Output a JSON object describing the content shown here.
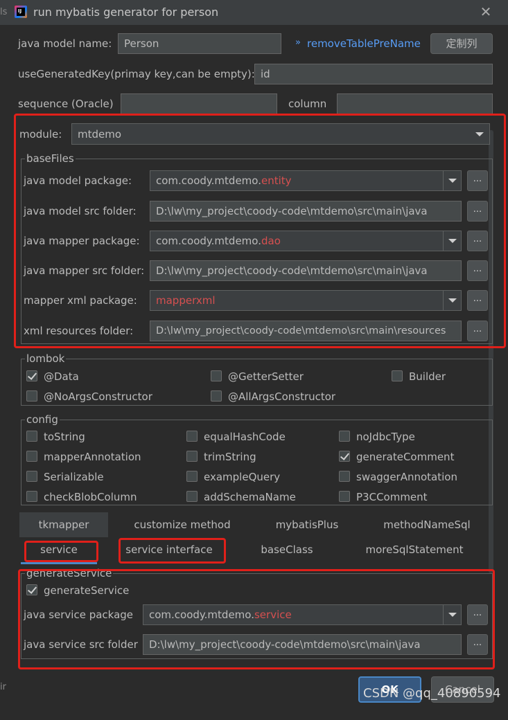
{
  "window": {
    "title": "run mybatis generator for person",
    "side_text": "ls",
    "side_text2": "ir"
  },
  "top": {
    "model_name_label": "java model name:",
    "model_name_value": "Person",
    "remove_prefix_link": "removeTablePreName",
    "custom_cols_button": "定制列",
    "use_generated_key_label": "useGeneratedKey(primay key,can be empty):",
    "use_generated_key_value": "id",
    "sequence_label": "sequence (Oracle)",
    "column_label": "column"
  },
  "module": {
    "label": "module:",
    "value": "mtdemo"
  },
  "basefiles": {
    "title": "baseFiles",
    "model_package_label": "java model package:",
    "model_package_prefix": "com.coody.mtdemo.",
    "model_package_suffix": "entity",
    "model_src_label": "java model src folder:",
    "model_src_value": "D:\\lw\\my_project\\coody-code\\mtdemo\\src\\main\\java",
    "mapper_package_label": "java mapper package:",
    "mapper_package_prefix": "com.coody.mtdemo.",
    "mapper_package_suffix": "dao",
    "mapper_src_label": "java mapper src folder:",
    "mapper_src_value": "D:\\lw\\my_project\\coody-code\\mtdemo\\src\\main\\java",
    "xml_package_label": "mapper xml package:",
    "xml_package_value": "mapperxml",
    "xml_resources_label": "xml resources folder:",
    "xml_resources_value": "D:\\lw\\my_project\\coody-code\\mtdemo\\src\\main\\resources",
    "browse": "..."
  },
  "lombok": {
    "title": "lombok",
    "data": "@Data",
    "getter_setter": "@GetterSetter",
    "builder": "Builder",
    "no_args": "@NoArgsConstructor",
    "all_args": "@AllArgsConstructor"
  },
  "config": {
    "title": "config",
    "to_string": "toString",
    "equal_hash_code": "equalHashCode",
    "no_jdbc_type": "noJdbcType",
    "mapper_annotation": "mapperAnnotation",
    "trim_string": "trimString",
    "generate_comment": "generateComment",
    "serializable": "Serializable",
    "example_query": "exampleQuery",
    "swagger_annotation": "swaggerAnnotation",
    "check_blob_column": "checkBlobColumn",
    "add_schema_name": "addSchemaName",
    "p3c_comment": "P3CComment"
  },
  "tabs": {
    "tkmapper": "tkmapper",
    "customize_method": "customize method",
    "mybatis_plus": "mybatisPlus",
    "method_name_sql": "methodNameSql",
    "service": "service",
    "service_interface": "service interface",
    "base_class": "baseClass",
    "more_sql": "moreSqlStatement"
  },
  "service": {
    "title": "generateService",
    "generate_label": "generateService",
    "package_label": "java service package",
    "package_prefix": "com.coody.mtdemo.",
    "package_suffix": "service",
    "src_label": "java service src folder",
    "src_value": "D:\\lw\\my_project\\coody-code\\mtdemo\\src\\main\\java"
  },
  "buttons": {
    "ok": "OK",
    "cancel": "Cancel"
  },
  "watermark": "CSDN @qq_40890594",
  "colors": {
    "bg": "#2b2b2b",
    "link": "#589df6",
    "highlight_red": "#e0201a",
    "accent_text_red": "#d65050"
  }
}
